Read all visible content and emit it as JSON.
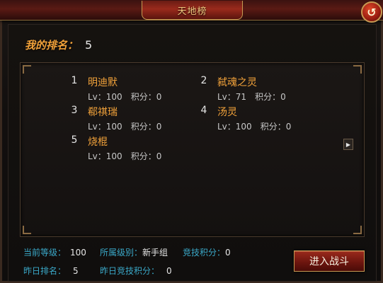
{
  "window": {
    "title": "天地榜"
  },
  "my_rank": {
    "label": "我的排名：",
    "value": "5"
  },
  "rankings": [
    {
      "rank": "1",
      "name": "明迪默",
      "level": "Lv：100",
      "points": "积分：0"
    },
    {
      "rank": "2",
      "name": "弑魂之灵",
      "level": "Lv：71",
      "points": "积分：0"
    },
    {
      "rank": "3",
      "name": "郗祺瑞",
      "level": "Lv：100",
      "points": "积分：0"
    },
    {
      "rank": "4",
      "name": "汤灵",
      "level": "Lv：100",
      "points": "积分：0"
    },
    {
      "rank": "5",
      "name": "烧棍",
      "level": "Lv：100",
      "points": "积分：0"
    }
  ],
  "footer": {
    "current_level_label": "当前等级：",
    "current_level_value": "100",
    "group_label": "所属级别：",
    "group_value": "新手组",
    "arena_points_label": "竞技积分：",
    "arena_points_value": "0",
    "yesterday_rank_label": "昨日排名：",
    "yesterday_rank_value": "5",
    "yesterday_points_label": "昨日竞技积分：",
    "yesterday_points_value": "0"
  },
  "buttons": {
    "enter_battle": "进入战斗",
    "back": "↺"
  },
  "icons": {
    "back": "back-arrow-icon",
    "next_page": "next-page-arrow-icon"
  }
}
